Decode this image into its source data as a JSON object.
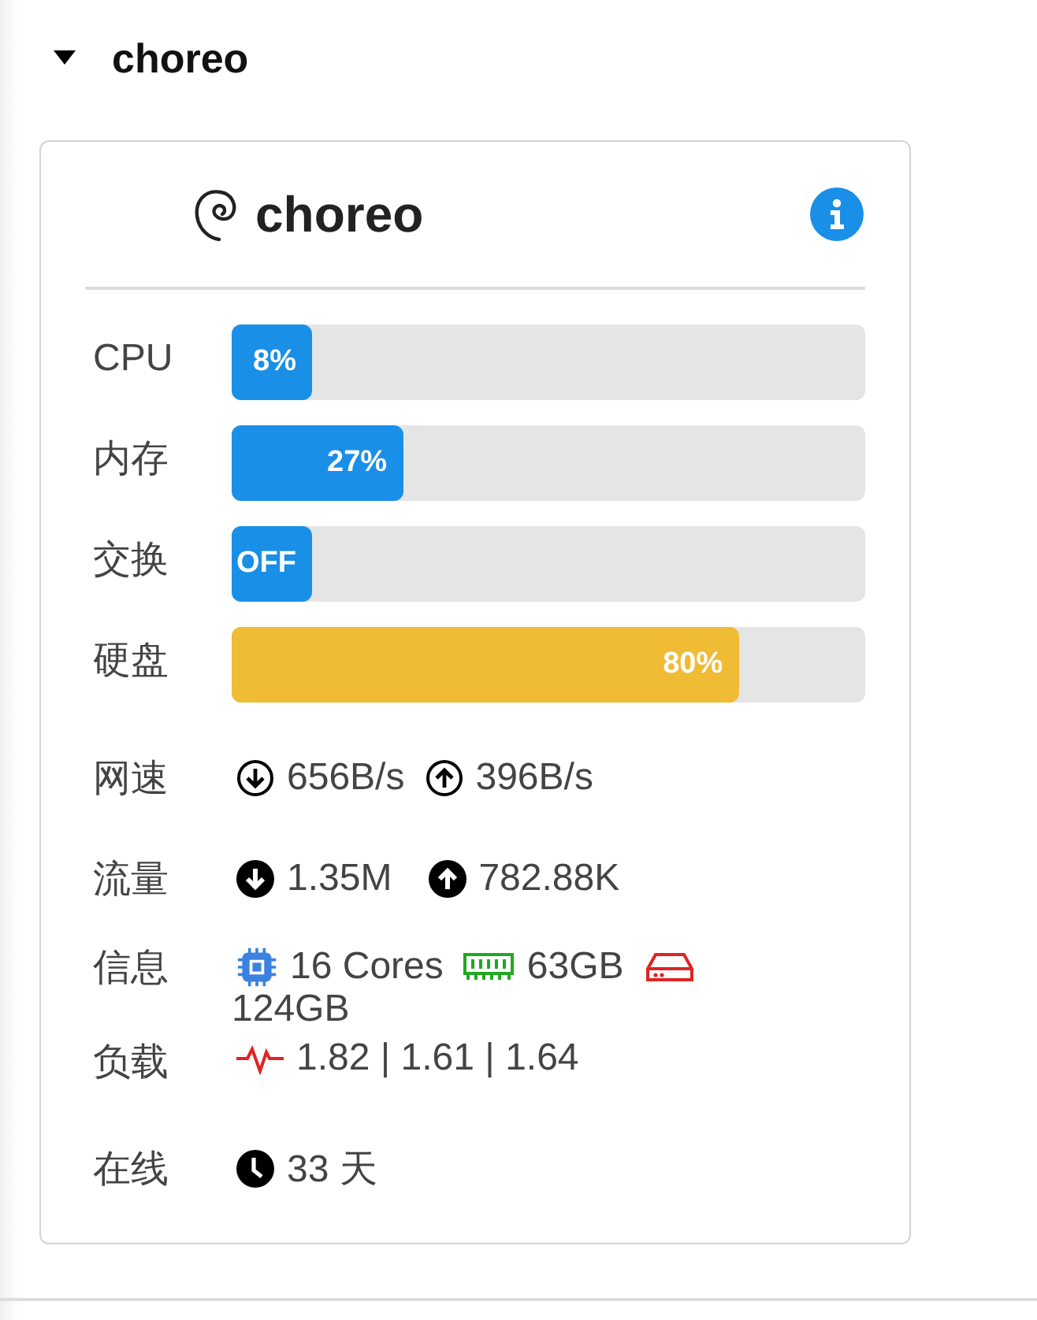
{
  "section": {
    "title": "choreo",
    "expanded": true
  },
  "card": {
    "name": "choreo",
    "bars": [
      {
        "label": "CPU",
        "level": 0.08,
        "text": "8%",
        "color": "#1a8fe8"
      },
      {
        "label": "内存",
        "level": 0.27,
        "text": "27%",
        "color": "#1a8fe8"
      },
      {
        "label": "交换",
        "level": 0,
        "text": "OFF",
        "color": "#1a8fe8"
      },
      {
        "label": "硬盘",
        "level": 0.8,
        "text": "80%",
        "color": "#f0bc35"
      }
    ],
    "network_speed": {
      "label": "网速",
      "down": "656B/s",
      "up": "396B/s"
    },
    "traffic": {
      "label": "流量",
      "down": "1.35M",
      "up": "782.88K"
    },
    "info": {
      "label": "信息",
      "cores": "16 Cores",
      "memory": "63GB",
      "disk": "124GB"
    },
    "load": {
      "label": "负载",
      "value": "1.82 | 1.61 | 1.64"
    },
    "online": {
      "label": "在线",
      "value": "33 天"
    }
  }
}
